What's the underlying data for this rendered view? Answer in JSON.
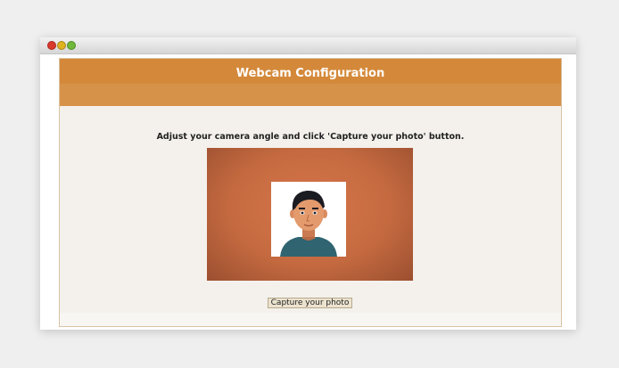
{
  "window": {
    "controls": [
      "close",
      "minimize",
      "maximize"
    ]
  },
  "header": {
    "title": "Webcam Configuration"
  },
  "main": {
    "instruction": "Adjust your camera angle and click 'Capture your photo' button.",
    "capture_button_label": "Capture your photo"
  },
  "colors": {
    "header_bg": "#d4893a",
    "camera_bg": "#c56a40",
    "panel_bg": "#f4f1ec"
  },
  "icons": {
    "photo": "person-avatar-icon"
  }
}
